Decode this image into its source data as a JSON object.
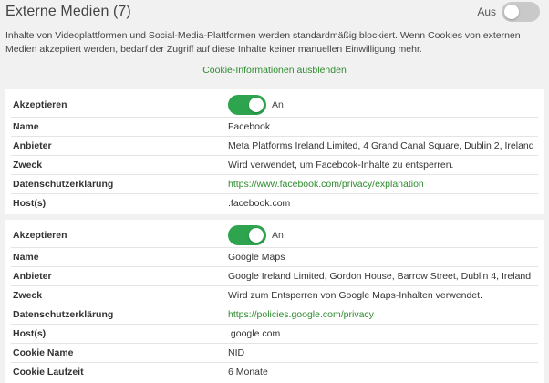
{
  "header": {
    "title": "Externe Medien (7)",
    "toggle_label": "Aus"
  },
  "description": "Inhalte von Videoplattformen und Social-Media-Plattformen werden standardmäßig blockiert. Wenn Cookies von externen Medien akzeptiert werden, bedarf der Zugriff auf diese Inhalte keiner manuellen Einwilligung mehr.",
  "info_link": "Cookie-Informationen ausblenden",
  "labels": {
    "accept": "Akzeptieren",
    "name": "Name",
    "provider": "Anbieter",
    "purpose": "Zweck",
    "privacy": "Datenschutzerklärung",
    "hosts": "Host(s)",
    "cookie_name": "Cookie Name",
    "cookie_duration": "Cookie Laufzeit"
  },
  "services": [
    {
      "accept_state": "An",
      "name": "Facebook",
      "provider": "Meta Platforms Ireland Limited, 4 Grand Canal Square, Dublin 2, Ireland",
      "purpose": "Wird verwendet, um Facebook-Inhalte zu entsperren.",
      "privacy_url": "https://www.facebook.com/privacy/explanation",
      "hosts": ".facebook.com"
    },
    {
      "accept_state": "An",
      "name": "Google Maps",
      "provider": "Google Ireland Limited, Gordon House, Barrow Street, Dublin 4, Ireland",
      "purpose": "Wird zum Entsperren von Google Maps-Inhalten verwendet.",
      "privacy_url": "https://policies.google.com/privacy",
      "hosts": ".google.com",
      "cookie_name": "NID",
      "cookie_duration": "6 Monate"
    }
  ],
  "colors": {
    "accent_green": "#2ea44f",
    "link_green": "#2e8b2e",
    "toggle_off": "#c9c9c9"
  }
}
